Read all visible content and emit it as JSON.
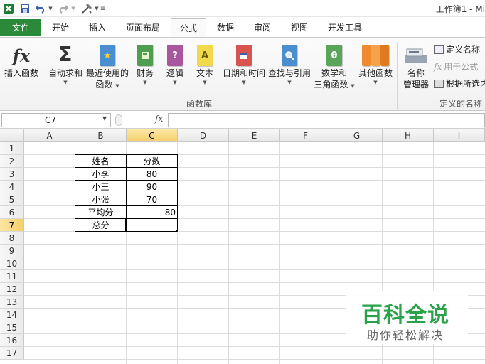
{
  "window": {
    "title": "工作簿1 - Mi"
  },
  "tabs": [
    {
      "label": "文件"
    },
    {
      "label": "开始"
    },
    {
      "label": "插入"
    },
    {
      "label": "页面布局"
    },
    {
      "label": "公式"
    },
    {
      "label": "数据"
    },
    {
      "label": "审阅"
    },
    {
      "label": "视图"
    },
    {
      "label": "开发工具"
    }
  ],
  "ribbon": {
    "insert_function": "插入函数",
    "autosum": "自动求和",
    "recent_line1": "最近使用的",
    "recent_line2": "函数",
    "financial": "财务",
    "logical": "逻辑",
    "text": "文本",
    "datetime": "日期和时间",
    "lookup": "查找与引用",
    "math_line1": "数学和",
    "math_line2": "三角函数",
    "more": "其他函数",
    "name_manager_line1": "名称",
    "name_manager_line2": "管理器",
    "define_name": "定义名称",
    "use_in_formula": "用于公式",
    "create_from_selection": "根据所选内",
    "group_function_library": "函数库",
    "group_defined_names": "定义的名称",
    "icon_fx": "fx",
    "icon_sigma": "Σ",
    "icon_logic": "?",
    "icon_text": "A",
    "icon_math": "θ"
  },
  "formula_bar": {
    "name_box": "C7",
    "fx_label": "fx",
    "value": ""
  },
  "columns": [
    "A",
    "B",
    "C",
    "D",
    "E",
    "F",
    "G",
    "H",
    "I"
  ],
  "rows": [
    "1",
    "2",
    "3",
    "4",
    "5",
    "6",
    "7",
    "8",
    "9",
    "10",
    "11",
    "12",
    "13",
    "14",
    "15",
    "16",
    "17"
  ],
  "table": {
    "header": {
      "name": "姓名",
      "score": "分数"
    },
    "rows": [
      {
        "name": "小李",
        "score": "80"
      },
      {
        "name": "小王",
        "score": "90"
      },
      {
        "name": "小张",
        "score": "70"
      }
    ],
    "average_label": "平均分",
    "average_value": "80",
    "total_label": "总分",
    "total_value": ""
  },
  "watermark": {
    "title": "百科全说",
    "subtitle": "助你轻松解决"
  },
  "colors": {
    "file_tab": "#2a8a3a",
    "selection_header": "#f5cf6b",
    "watermark": "#2aa24a"
  }
}
